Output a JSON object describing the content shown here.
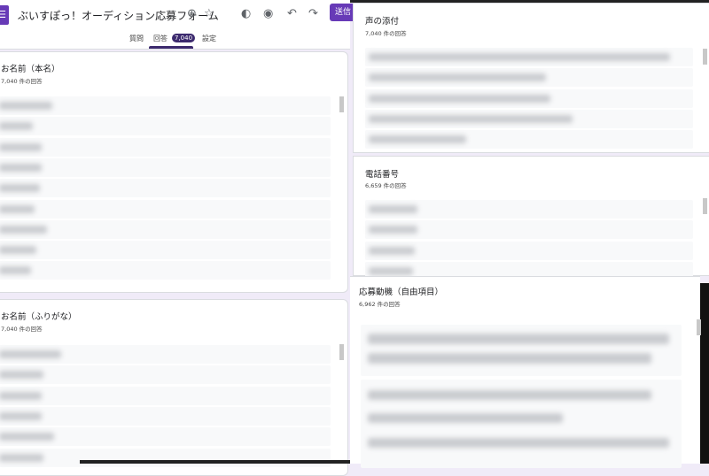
{
  "header": {
    "form_title": "ぶいすぽっ！オーディション応募フォーム",
    "send_label": "送信",
    "tabs": [
      {
        "label": "質問"
      },
      {
        "label": "回答",
        "badge": "7,040"
      },
      {
        "label": "設定"
      }
    ],
    "active_tab": "回答"
  },
  "colors": {
    "accent": "#673ab7",
    "badge": "#3c2a6e"
  },
  "questions": [
    {
      "title": "お名前（本名）",
      "count": "7,040 件の回答"
    },
    {
      "title": "お名前（ふりがな）",
      "count": "7,040 件の回答"
    },
    {
      "title": "声の添付",
      "count": "7,040 件の回答"
    },
    {
      "title": "電話番号",
      "count": "6,659 件の回答"
    },
    {
      "title": "応募動機（自由項目）",
      "count": "6,962 件の回答"
    }
  ]
}
